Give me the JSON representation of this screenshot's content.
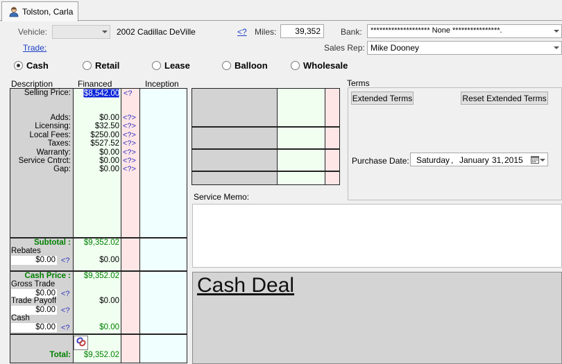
{
  "tab": {
    "customer_name": "Tolston, Carla"
  },
  "header": {
    "vehicle_label": "Vehicle:",
    "vehicle_value": "2002 Cadillac DeVille",
    "vehicle_link": "<?",
    "trade_link": "Trade:",
    "miles_label": "Miles:",
    "miles_value": "39,352",
    "bank_label": "Bank:",
    "bank_value": "******************** None ****************.",
    "sales_rep_label": "Sales Rep:",
    "sales_rep_value": "Mike Dooney"
  },
  "deal_types": [
    {
      "label": "Cash",
      "selected": true
    },
    {
      "label": "Retail",
      "selected": false
    },
    {
      "label": "Lease",
      "selected": false
    },
    {
      "label": "Balloon",
      "selected": false
    },
    {
      "label": "Wholesale",
      "selected": false
    }
  ],
  "worksheet": {
    "headers": {
      "description": "Description",
      "financed": "Financed",
      "inception": "Inception"
    },
    "selling_price": {
      "label": "Selling Price:",
      "value": "$8,542.00",
      "q": "<?"
    },
    "lines": [
      {
        "label": "Adds:",
        "value": "$0.00",
        "q": "<?>"
      },
      {
        "label": "Licensing:",
        "value": "$32.50",
        "q": "<?>"
      },
      {
        "label": "Local Fees:",
        "value": "$250.00",
        "q": "<?>"
      },
      {
        "label": "Taxes:",
        "value": "$527.52",
        "q": "<?>"
      },
      {
        "label": "Warranty:",
        "value": "$0.00",
        "q": "<?>"
      },
      {
        "label": "Service Cntrct:",
        "value": "$0.00",
        "q": "<?>"
      },
      {
        "label": "Gap:",
        "value": "$0.00",
        "q": "<?>"
      }
    ],
    "subtotal": {
      "label": "Subtotal :",
      "value": "$9,352.02"
    },
    "rebates": {
      "label": "Rebates",
      "input": "$0.00",
      "q": "<?",
      "value": "$0.00"
    },
    "cash_price": {
      "label": "Cash Price :",
      "value": "$9,352.02"
    },
    "gross_trade": {
      "label": "Gross Trade",
      "input": "$0.00",
      "q": "<?"
    },
    "trade_payoff": {
      "label": "Trade Payoff",
      "input": "$0.00",
      "q": "<?",
      "value": "$0.00"
    },
    "cash": {
      "label": "Cash",
      "input": "$0.00",
      "q": "<?",
      "value": "$0.00"
    },
    "total": {
      "label": "Total:",
      "value": "$9,352.02"
    }
  },
  "terms": {
    "title": "Terms",
    "extended_terms_button": "Extended Terms",
    "reset_extended_terms_button": "Reset Extended Terms",
    "purchase_date_label": "Purchase Date:",
    "purchase_date_day": "Saturday",
    "purchase_date_sep": ",",
    "purchase_date_month": "January",
    "purchase_date_daynum": "31,",
    "purchase_date_year": "2015"
  },
  "service_memo": {
    "label": "Service Memo:",
    "value": ""
  },
  "deal_banner": {
    "text": "Cash Deal"
  },
  "colors": {
    "description_col": "#d3d3d3",
    "financed_col": "#f0fff0",
    "q_col": "#ffe6e6",
    "inception_col": "#f0ffff",
    "link": "#1a3ec8",
    "total_green": "#008000"
  }
}
